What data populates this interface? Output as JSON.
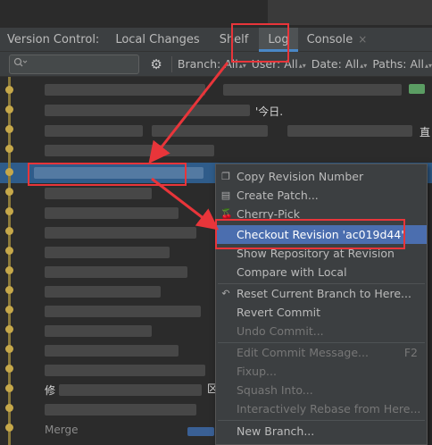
{
  "toolwindow": {
    "title": "Version Control:",
    "tabs": [
      "Local Changes",
      "Shelf",
      "Log",
      "Console"
    ],
    "close_glyph": "×"
  },
  "filters": {
    "search_icon": "search-icon",
    "settings_icon": "gear-icon",
    "branch": "Branch: All",
    "user": "User: All",
    "date": "Date: All",
    "paths": "Paths: All"
  },
  "log": {
    "visible_texts": [
      "'今日.",
      "直",
      "修",
      "Merge",
      "区"
    ]
  },
  "context_menu": {
    "items": [
      {
        "label": "Copy Revision Number",
        "icon": "copy-icon"
      },
      {
        "label": "Create Patch...",
        "icon": "patch-icon"
      },
      {
        "label": "Cherry-Pick",
        "icon": "cherry-pick-icon"
      },
      {
        "label": "Checkout Revision 'ac019d44'",
        "highlighted": true
      },
      {
        "label": "Show Repository at Revision"
      },
      {
        "label": "Compare with Local"
      },
      {
        "label": "Reset Current Branch to Here...",
        "icon": "reset-icon"
      },
      {
        "label": "Revert Commit"
      },
      {
        "label": "Undo Commit...",
        "disabled": true
      },
      {
        "label": "Edit Commit Message...",
        "shortcut": "F2",
        "disabled": true
      },
      {
        "label": "Fixup...",
        "disabled": true
      },
      {
        "label": "Squash Into...",
        "disabled": true
      },
      {
        "label": "Interactively Rebase from Here...",
        "disabled": true
      },
      {
        "label": "New Branch..."
      }
    ]
  },
  "colors": {
    "annotation_red": "#e8353a",
    "selection_blue": "#2f5c8a",
    "menu_highlight": "#4b6eaf"
  }
}
